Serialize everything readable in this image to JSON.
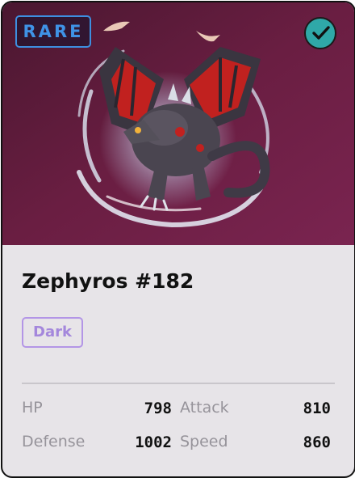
{
  "card": {
    "rarity": "RARE",
    "verified_icon": "check-circle-icon",
    "name": "Zephyros #182",
    "type": "Dark",
    "colors": {
      "art_background": "#6e1f43",
      "rarity": "#3f93e6",
      "type_badge": "#a487dc",
      "verified": "#2fa8a8"
    },
    "stats": [
      {
        "label": "HP",
        "value": "798"
      },
      {
        "label": "Attack",
        "value": "810"
      },
      {
        "label": "Defense",
        "value": "1002"
      },
      {
        "label": "Speed",
        "value": "860"
      }
    ]
  }
}
